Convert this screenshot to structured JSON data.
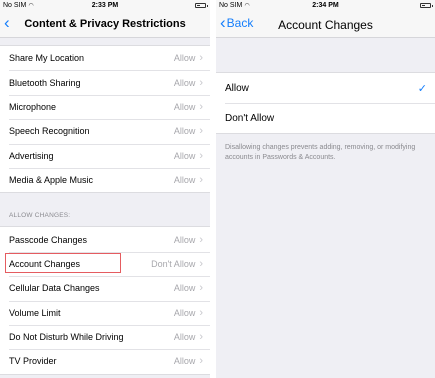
{
  "left": {
    "status": {
      "carrier": "No SIM",
      "time": "2:33 PM"
    },
    "nav": {
      "title": "Content & Privacy Restrictions"
    },
    "group1": [
      {
        "label": "Share My Location",
        "value": "Allow"
      },
      {
        "label": "Bluetooth Sharing",
        "value": "Allow"
      },
      {
        "label": "Microphone",
        "value": "Allow"
      },
      {
        "label": "Speech Recognition",
        "value": "Allow"
      },
      {
        "label": "Advertising",
        "value": "Allow"
      },
      {
        "label": "Media & Apple Music",
        "value": "Allow"
      }
    ],
    "section_header": "ALLOW CHANGES:",
    "group2": [
      {
        "label": "Passcode Changes",
        "value": "Allow"
      },
      {
        "label": "Account Changes",
        "value": "Don't Allow"
      },
      {
        "label": "Cellular Data Changes",
        "value": "Allow"
      },
      {
        "label": "Volume Limit",
        "value": "Allow"
      },
      {
        "label": "Do Not Disturb While Driving",
        "value": "Allow"
      },
      {
        "label": "TV Provider",
        "value": "Allow"
      }
    ]
  },
  "right": {
    "status": {
      "carrier": "No SIM",
      "time": "2:34 PM"
    },
    "nav": {
      "back_label": "Back",
      "title": "Account Changes"
    },
    "options": [
      {
        "label": "Allow",
        "selected": true
      },
      {
        "label": "Don't Allow",
        "selected": false
      }
    ],
    "footer": "Disallowing changes prevents adding, removing, or modifying accounts in Passwords & Accounts."
  },
  "colors": {
    "accent": "#157efb",
    "highlight": "#e55c60"
  }
}
